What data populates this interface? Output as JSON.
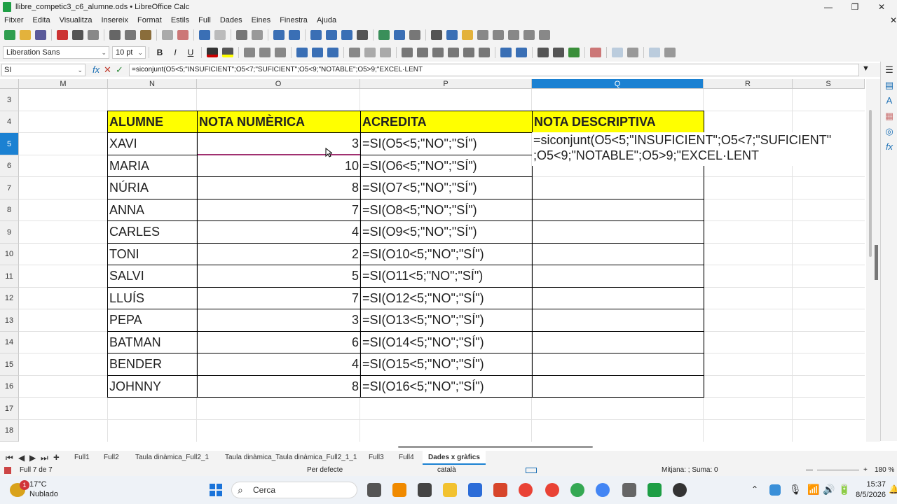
{
  "window": {
    "title": "llibre_competic3_c6_alumne.ods • LibreOffice Calc",
    "controls": {
      "minimize": "—",
      "maximize": "❐",
      "close": "✕"
    }
  },
  "menu": [
    "Fitxer",
    "Edita",
    "Visualitza",
    "Insereix",
    "Format",
    "Estils",
    "Full",
    "Dades",
    "Eines",
    "Finestra",
    "Ajuda"
  ],
  "format_toolbar": {
    "font_name": "Liberation Sans",
    "font_size": "10 pt",
    "bold": "B",
    "italic": "I",
    "underline": "U"
  },
  "formula_bar": {
    "name_box": "SI",
    "fx": "fx",
    "cancel": "✕",
    "accept": "✓",
    "content": "=siconjunt(O5<5;\"INSUFICIENT\";O5<7;\"SUFICIENT\";O5<9;\"NOTABLE\";O5>9;\"EXCEL·LENT"
  },
  "columns": [
    "M",
    "N",
    "O",
    "P",
    "Q",
    "R",
    "S"
  ],
  "selected_column": "Q",
  "rows": [
    "3",
    "4",
    "5",
    "6",
    "7",
    "8",
    "9",
    "10",
    "11",
    "12",
    "13",
    "14",
    "15",
    "16",
    "17",
    "18"
  ],
  "selected_row": "5",
  "table": {
    "headers": [
      "ALUMNE",
      "NOTA NUMÈRICA",
      "ACREDITA",
      "NOTA DESCRIPTIVA"
    ],
    "records": [
      {
        "name": "XAVI",
        "grade": "3",
        "formula": "=SI(O5<5;\"NO\";\"SÍ\")"
      },
      {
        "name": "MARIA",
        "grade": "10",
        "formula": "=SI(O6<5;\"NO\";\"SÍ\")"
      },
      {
        "name": "NÚRIA",
        "grade": "8",
        "formula": "=SI(O7<5;\"NO\";\"SÍ\")"
      },
      {
        "name": "ANNA",
        "grade": "7",
        "formula": "=SI(O8<5;\"NO\";\"SÍ\")"
      },
      {
        "name": "CARLES",
        "grade": "4",
        "formula": "=SI(O9<5;\"NO\";\"SÍ\")"
      },
      {
        "name": "TONI",
        "grade": "2",
        "formula": "=SI(O10<5;\"NO\";\"SÍ\")"
      },
      {
        "name": "SALVI",
        "grade": "5",
        "formula": "=SI(O11<5;\"NO\";\"SÍ\")"
      },
      {
        "name": "LLUÍS",
        "grade": "7",
        "formula": "=SI(O12<5;\"NO\";\"SÍ\")"
      },
      {
        "name": "PEPA",
        "grade": "3",
        "formula": "=SI(O13<5;\"NO\";\"SÍ\")"
      },
      {
        "name": "BATMAN",
        "grade": "6",
        "formula": "=SI(O14<5;\"NO\";\"SÍ\")"
      },
      {
        "name": "BENDER",
        "grade": "4",
        "formula": "=SI(O15<5;\"NO\";\"SÍ\")"
      },
      {
        "name": "JOHNNY",
        "grade": "8",
        "formula": "=SI(O16<5;\"NO\";\"SÍ\")"
      }
    ]
  },
  "editing_cell": {
    "line1": "=siconjunt(O5<5;\"INSUFICIENT\";O5<7;\"SUFICIENT\"",
    "line2": ";O5<9;\"NOTABLE\";O5>9;\"EXCEL·LENT"
  },
  "sheet_tabs": [
    "Full1",
    "Full2",
    "Taula dinàmica_Full2_1",
    "Taula dinàmica_Taula dinàmica_Full2_1_1",
    "Full3",
    "Full4",
    "Dades x gràfics"
  ],
  "active_tab": "Dades x gràfics",
  "status_bar": {
    "sheet": "Full 7 de 7",
    "page_style": "Per defecte",
    "language": "català",
    "summary": "Mitjana: ; Suma: 0",
    "zoom": "180 %"
  },
  "taskbar": {
    "weather_temp": "17°C",
    "weather_desc": "Nublado",
    "notification_count": "1",
    "search_placeholder": "Cerca",
    "time": "15:37",
    "date": "8/5/2026"
  },
  "colors": {
    "header_fill": "#ffff00",
    "selection": "#1b81d2",
    "calc_green": "#1e9e45"
  }
}
